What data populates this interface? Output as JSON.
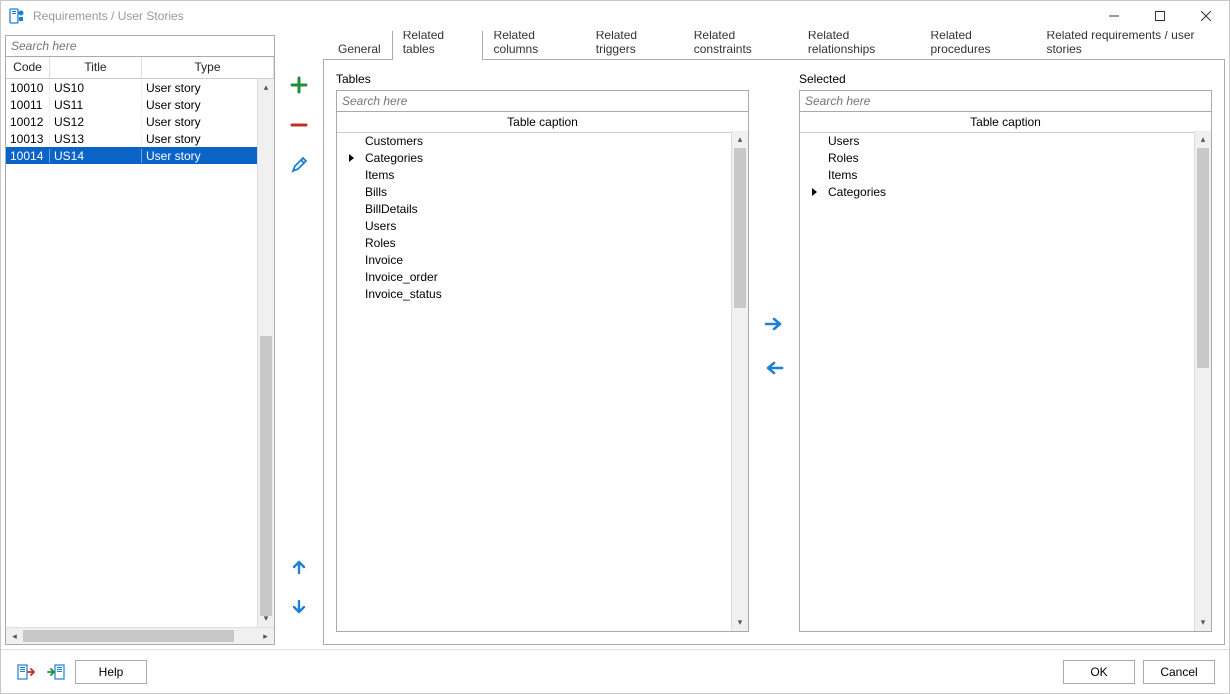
{
  "window": {
    "title": "Requirements / User Stories"
  },
  "search_placeholder": "Search here",
  "grid": {
    "headers": {
      "code": "Code",
      "title": "Title",
      "type": "Type"
    },
    "rows": [
      {
        "code": "10010",
        "title": "US10",
        "type": "User story"
      },
      {
        "code": "10011",
        "title": "US11",
        "type": "User story"
      },
      {
        "code": "10012",
        "title": "US12",
        "type": "User story"
      },
      {
        "code": "10013",
        "title": "US13",
        "type": "User story"
      },
      {
        "code": "10014",
        "title": "US14",
        "type": "User story"
      }
    ],
    "selected_index": 4
  },
  "tabs": [
    "General",
    "Related tables",
    "Related columns",
    "Related triggers",
    "Related constraints",
    "Related relationships",
    "Related procedures",
    "Related requirements / user stories"
  ],
  "active_tab_index": 1,
  "tables_panel": {
    "label": "Tables",
    "caption": "Table caption",
    "items": [
      "Customers",
      "Categories",
      "Items",
      "Bills",
      "BillDetails",
      "Users",
      "Roles",
      "Invoice",
      "Invoice_order",
      "Invoice_status"
    ],
    "current_index": 1
  },
  "selected_panel": {
    "label": "Selected",
    "caption": "Table caption",
    "items": [
      "Users",
      "Roles",
      "Items",
      "Categories"
    ],
    "current_index": 3
  },
  "buttons": {
    "help": "Help",
    "ok": "OK",
    "cancel": "Cancel"
  }
}
